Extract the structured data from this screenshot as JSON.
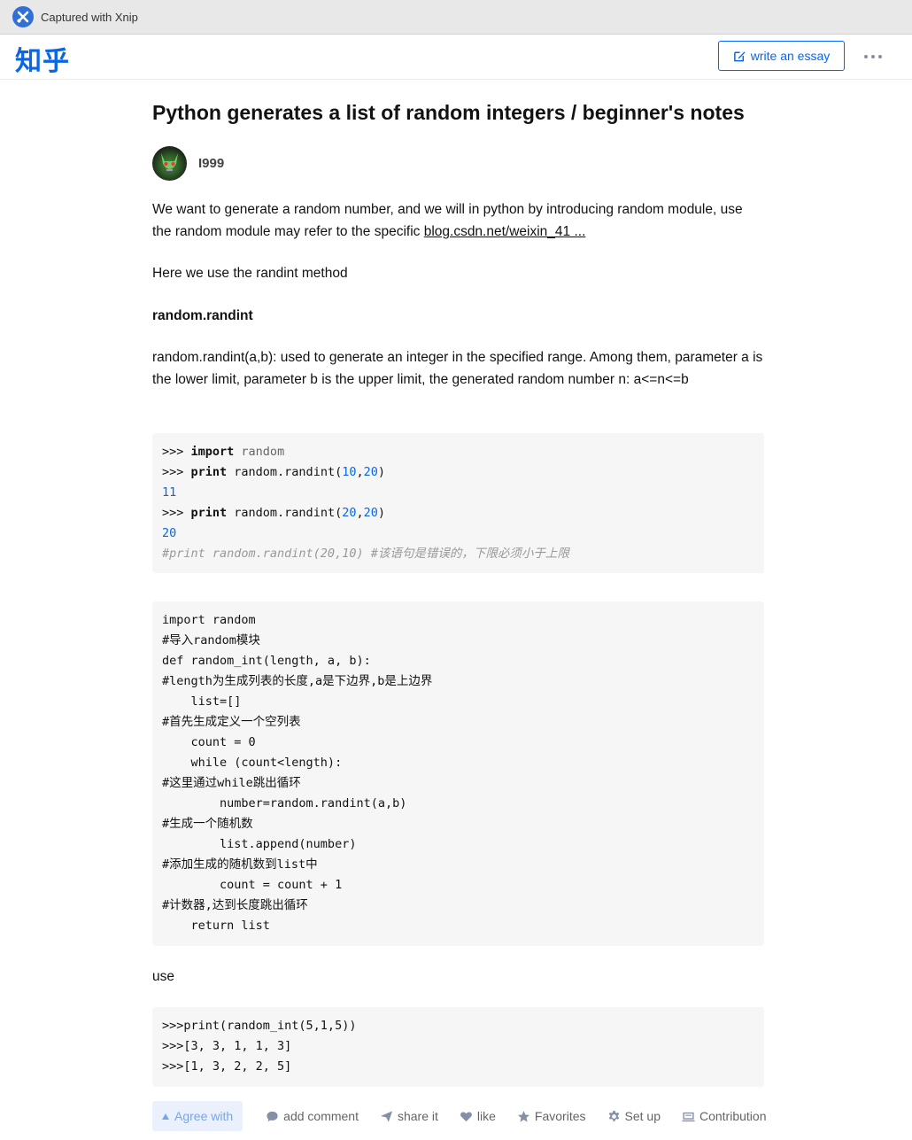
{
  "capture": {
    "text": "Captured with Xnip"
  },
  "header": {
    "logo": "知乎",
    "write_label": "write an essay"
  },
  "article": {
    "title": "Python generates a list of random integers / beginner's notes",
    "author": "I999",
    "p1_text": "We want to generate a random number, and we will in python by introducing random module, use the random module may refer to the specific ",
    "p1_link": "blog.csdn.net/weixin_41 ...",
    "p2": "Here we use the randint method",
    "h1": "random.randint",
    "p3": "random.randint(a,b): used to generate an integer in the specified range. Among them, parameter a is the lower limit, parameter b is the upper limit, the generated random number n: a<=n<=b",
    "code1": {
      "l1_prompt": ">>> ",
      "l1_kw": "import",
      "l1_rest": " random",
      "l2_prompt": ">>> ",
      "l2_kw": "print",
      "l2_rest": " random.randint(",
      "l2_a": "10",
      "l2_comma": ",",
      "l2_b": "20",
      "l2_end": ")",
      "l3": "11",
      "l4_prompt": ">>> ",
      "l4_kw": "print",
      "l4_rest": " random.randint(",
      "l4_a": "20",
      "l4_comma": ",",
      "l4_b": "20",
      "l4_end": ")",
      "l5": "20",
      "l6": "#print random.randint(20,10) #该语句是错误的，下限必须小于上限"
    },
    "code2": "import random\n#导入random模块\ndef random_int(length, a, b):\n#length为生成列表的长度,a是下边界,b是上边界\n    list=[]\n#首先生成定义一个空列表\n    count = 0\n    while (count<length):\n#这里通过while跳出循环\n        number=random.randint(a,b)\n#生成一个随机数\n        list.append(number)\n#添加生成的随机数到list中\n        count = count + 1\n#计数器,达到长度跳出循环\n    return list",
    "p4": "use",
    "code3": ">>>print(random_int(5,1,5))\n>>>[3, 3, 1, 1, 3]\n>>>[1, 3, 2, 2, 5]"
  },
  "actions": {
    "vote": "Agree with",
    "comment": "add comment",
    "share": "share it",
    "like": "like",
    "favorites": "Favorites",
    "setup": "Set up",
    "contribution": "Contribution"
  }
}
